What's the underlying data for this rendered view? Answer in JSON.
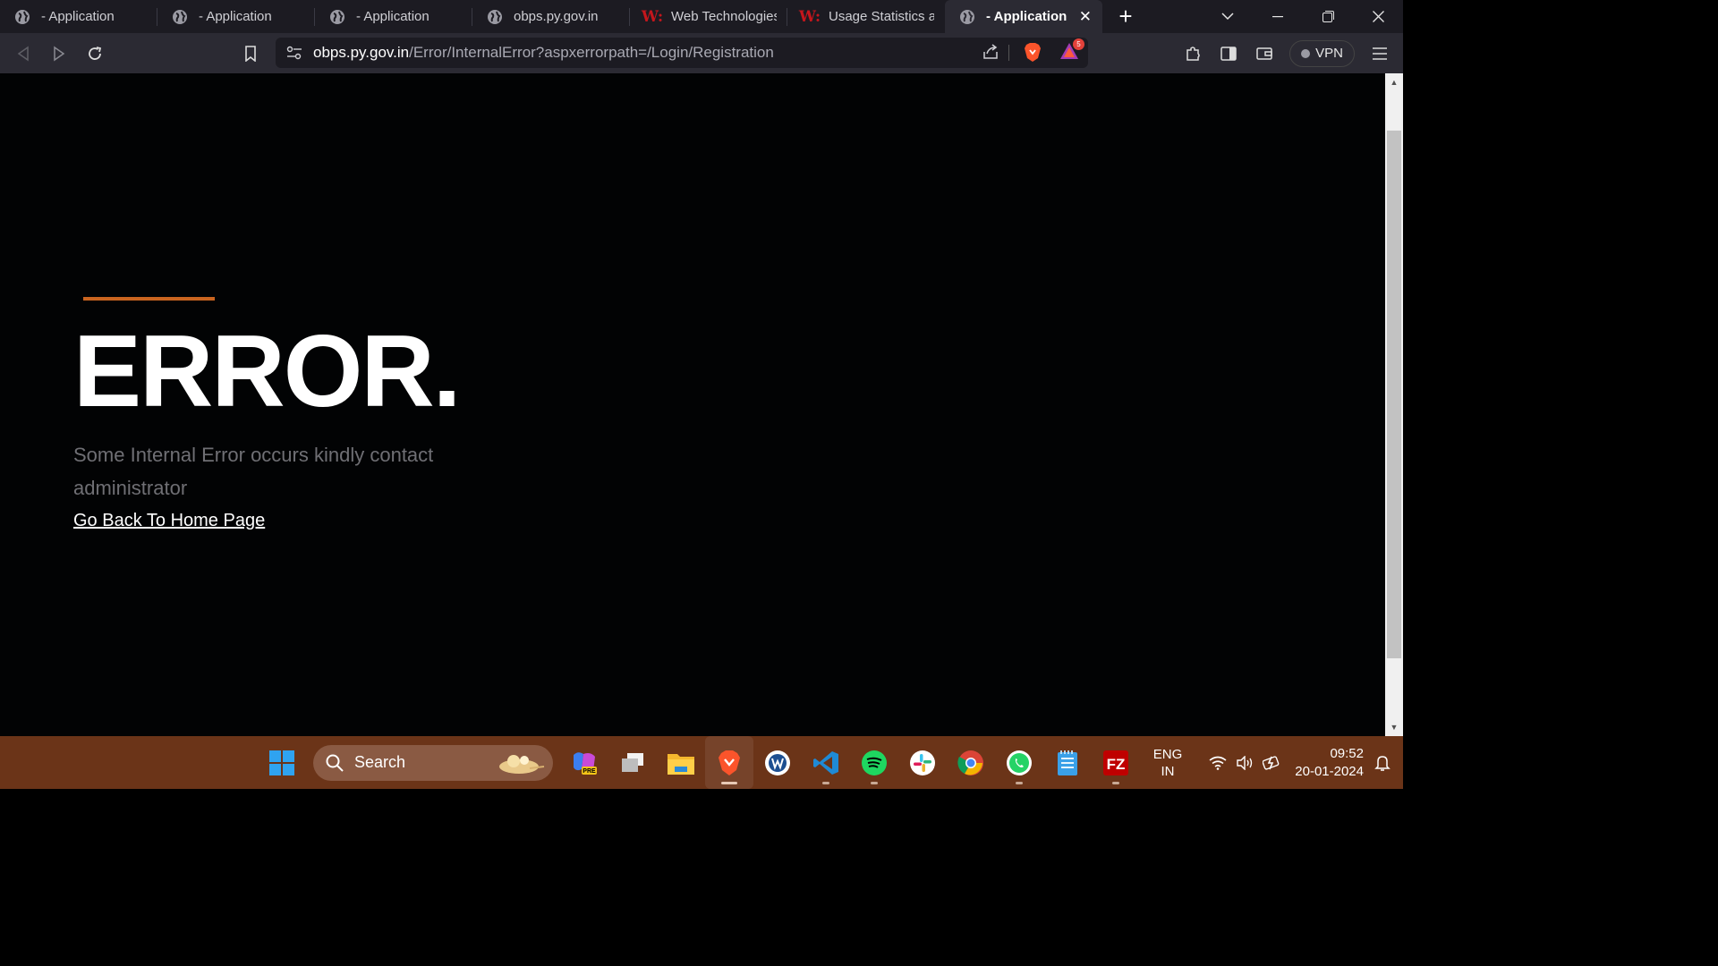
{
  "tabs": [
    {
      "label": "- Application",
      "icon": "globe-icon"
    },
    {
      "label": "- Application",
      "icon": "globe-icon"
    },
    {
      "label": "- Application",
      "icon": "globe-icon"
    },
    {
      "label": "obps.py.gov.in",
      "icon": "globe-icon"
    },
    {
      "label": "Web Technologies u",
      "icon": "w3techs-icon"
    },
    {
      "label": "Usage Statistics and",
      "icon": "w3techs-icon"
    },
    {
      "label": "- Application",
      "icon": "globe-icon",
      "active": true
    }
  ],
  "url": {
    "host": "obps.py.gov.in",
    "path": "/Error/InternalError?aspxerrorpath=/Login/Registration"
  },
  "toolbar": {
    "vpn_label": "VPN",
    "notification_count": "5"
  },
  "page": {
    "title": "ERROR.",
    "message": "Some Internal Error occurs kindly contact administrator",
    "home_link": "Go Back To Home Page",
    "accent_color": "#c9641f",
    "background_color": "#020304"
  },
  "taskbar": {
    "search_label": "Search",
    "apps": [
      "start-icon",
      "search",
      "copilot-icon",
      "task-view-icon",
      "file-explorer-icon",
      "brave-icon",
      "wps-icon",
      "vscode-icon",
      "spotify-icon",
      "slack-icon",
      "chrome-icon",
      "whatsapp-icon",
      "notepad-icon",
      "filezilla-icon"
    ],
    "copilot_badge": "PRE",
    "language_top": "ENG",
    "language_bottom": "IN",
    "time": "09:52",
    "date": "20-01-2024"
  }
}
